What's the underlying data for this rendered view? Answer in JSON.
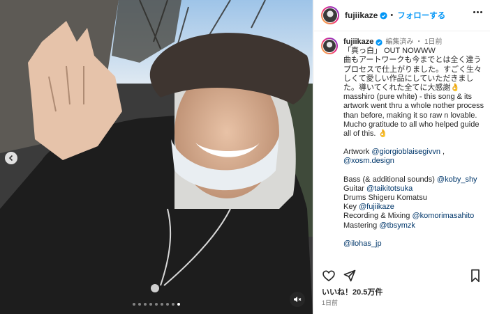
{
  "account": {
    "username": "fujiikaze",
    "follow_label": "フォローする",
    "separator": "•"
  },
  "caption": {
    "username": "fujiikaze",
    "meta": "編集済み ・ 1日前",
    "jp_title": "「真っ白」 OUT NOWWW",
    "jp_body": "曲もアートワークも今までとは全く違うプロセスで仕上がりました。すごく生々しくて愛しい作品にしていただきました。導いてくれた全てに大感謝👌",
    "en_body": "masshiro (pure white) - this song & its artwork went thru a whole nother process than before, making it so raw n lovable. Mucho gratitude to all who helped guide all of this. 👌",
    "credits": [
      {
        "label": "Artwork ",
        "handle": "@giorgioblaisegivvn",
        "suffix": " ,"
      },
      {
        "label": "",
        "handle": "@xosm.design",
        "suffix": ""
      },
      {
        "label": "Bass (& additional sounds) ",
        "handle": "@koby_shy",
        "suffix": ""
      },
      {
        "label": "Guitar ",
        "handle": "@taikitotsuka",
        "suffix": ""
      },
      {
        "label": "Drums Shigeru Komatsu",
        "handle": "",
        "suffix": ""
      },
      {
        "label": "Key ",
        "handle": "@fujiikaze",
        "suffix": ""
      },
      {
        "label": "Recording & Mixing ",
        "handle": "@komorimasahito",
        "suffix": ""
      },
      {
        "label": "Mastering ",
        "handle": "@tbsymzk",
        "suffix": ""
      }
    ],
    "label_handle": "@ilohas_jp"
  },
  "post": {
    "likes": "いいね！20.5万件",
    "time": "1日前"
  },
  "carousel": {
    "count": 9,
    "active_index": 8
  },
  "icons": {
    "verified": "verified-badge-icon",
    "more": "more-options-icon",
    "like": "heart-icon",
    "share": "send-icon",
    "save": "bookmark-icon",
    "mute": "speaker-muted-icon",
    "prev": "chevron-left-icon"
  },
  "colors": {
    "link": "#00376b",
    "follow": "#0095f6",
    "verified": "#0095f6"
  }
}
